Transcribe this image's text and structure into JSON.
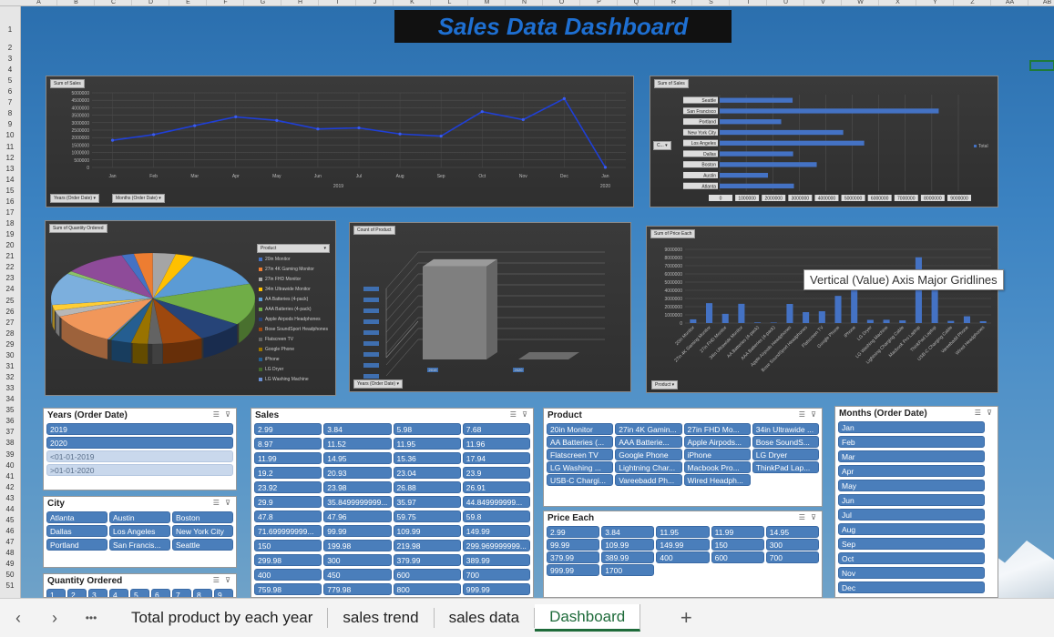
{
  "columns": [
    "A",
    "B",
    "C",
    "D",
    "E",
    "F",
    "G",
    "H",
    "I",
    "J",
    "K",
    "L",
    "M",
    "N",
    "O",
    "P",
    "Q",
    "R",
    "S",
    "T",
    "U",
    "V",
    "W",
    "X",
    "Y",
    "Z",
    "AA",
    "AB"
  ],
  "rows": [
    "1",
    "2",
    "3",
    "4",
    "5",
    "6",
    "7",
    "8",
    "9",
    "10",
    "11",
    "12",
    "13",
    "14",
    "15",
    "16",
    "17",
    "18",
    "19",
    "20",
    "21",
    "22",
    "23",
    "24",
    "25",
    "26",
    "27",
    "28",
    "29",
    "30",
    "31",
    "32",
    "33",
    "34",
    "35",
    "36",
    "37",
    "38",
    "39",
    "40",
    "41",
    "42",
    "43",
    "44",
    "45",
    "46",
    "47",
    "48",
    "49",
    "50",
    "51"
  ],
  "dashboard_title": "Sales Data Dashboard",
  "tooltip": "Vertical (Value) Axis Major Gridlines",
  "charts": {
    "line": {
      "tag": "Sum of Sales",
      "filter1": "Years (Order Date) ▾",
      "filter2": "Months (Order Date) ▾",
      "year1": "2019",
      "year2": "2020"
    },
    "city": {
      "tag": "Sum of Sales",
      "filter": "C... ▾",
      "legend": "Total"
    },
    "pie": {
      "tag": "Sum of Quantity Ordered",
      "legend_title": "Product"
    },
    "bar3d": {
      "tag": "Count of Product",
      "filter": "Years (Order Date) ▾",
      "x1": "2019",
      "x2": "2020"
    },
    "price": {
      "tag": "Sum of Price Each",
      "filter": "Product ▾"
    }
  },
  "chart_data": [
    {
      "type": "line",
      "title": "Sum of Sales",
      "categories": [
        "Jan",
        "Feb",
        "Mar",
        "Apr",
        "May",
        "Jun",
        "Jul",
        "Aug",
        "Sep",
        "Oct",
        "Nov",
        "Dec",
        "Jan"
      ],
      "values": [
        1820000,
        2200000,
        2800000,
        3390000,
        3150000,
        2580000,
        2650000,
        2240000,
        2100000,
        3740000,
        3200000,
        4610000,
        8700
      ],
      "yticks": [
        "5000000",
        "4500000",
        "4000000",
        "3500000",
        "3000000",
        "2500000",
        "2000000",
        "1500000",
        "1000000",
        "500000",
        "0"
      ],
      "ylim": [
        0,
        5000000
      ]
    },
    {
      "type": "bar",
      "title": "Sum of Sales",
      "orientation": "horizontal",
      "categories": [
        "Seattle",
        "San Francisco",
        "Portland",
        "New York City",
        "Los Angeles",
        "Dallas",
        "Boston",
        "Austin",
        "Atlanta"
      ],
      "values": [
        2750000,
        8260000,
        2320000,
        4660000,
        5450000,
        2770000,
        3660000,
        1820000,
        2800000
      ],
      "xticks": [
        "0",
        "1000000",
        "2000000",
        "3000000",
        "4000000",
        "5000000",
        "6000000",
        "7000000",
        "8000000",
        "9000000"
      ],
      "xlim": [
        0,
        9000000
      ],
      "legend": "Total"
    },
    {
      "type": "pie",
      "title": "Sum of Quantity Ordered",
      "labels": [
        "20in Monitor",
        "27in 4K Gaming Monitor",
        "27in FHD Monitor",
        "34in Ultrawide Monitor",
        "AA Batteries (4-pack)",
        "AAA Batteries (4-pack)",
        "Apple Airpods Headphones",
        "Bose SoundSport Headphones",
        "Flatscreen TV",
        "Google Phone",
        "iPhone",
        "LG Dryer",
        "LG Washing Machine",
        "Lightning Charging Cable",
        "Macbook Pro Laptop",
        "ThinkPad Laptop",
        "USB-C Charging Cable",
        "Vareebadd Phone",
        "Wired Headphones"
      ],
      "values": [
        4129,
        6244,
        7550,
        6199,
        27635,
        31017,
        15661,
        13457,
        4819,
        5532,
        6849,
        646,
        666,
        23217,
        4728,
        4130,
        23975,
        2068,
        20557
      ],
      "colors": [
        "#4472c4",
        "#ed7d31",
        "#a5a5a5",
        "#ffc000",
        "#5b9bd5",
        "#70ad47",
        "#264478",
        "#9e480e",
        "#636363",
        "#997300",
        "#255e91",
        "#43682b",
        "#698ed0",
        "#f1975a",
        "#b7b7b7",
        "#ffcd33",
        "#7cafdd",
        "#8cc168",
        "#8e4b99"
      ]
    },
    {
      "type": "bar",
      "title": "Count of Product",
      "categories": [
        "2019",
        "2020"
      ],
      "values": [
        185686,
        34
      ],
      "ylim": [
        0,
        200000
      ]
    },
    {
      "type": "bar",
      "title": "Sum of Price Each",
      "categories": [
        "20in Monitor",
        "27in 4K Gaming Monitor",
        "27in FHD Monitor",
        "34in Ultrawide Monitor",
        "AA Batteries (4-pack)",
        "AAA Batteries (4-pack)",
        "Apple Airpods Headphones",
        "Bose SoundSport Headphones",
        "Flatscreen TV",
        "Google Phone",
        "iPhone",
        "LG Dryer",
        "LG Washing Machine",
        "Lightning Charging Cable",
        "Macbook Pro Laptop",
        "ThinkPad Laptop",
        "USB-C Charging Cable",
        "Vareebadd Phone",
        "Wired Headphones"
      ],
      "values": [
        451068,
        2429637,
        1125974,
        2348718,
        79015,
        61716,
        2332350,
        1332367,
        1440000,
        3315000,
        4794300,
        387600,
        399600,
        323788,
        8030800,
        4127958,
        261740,
        826000,
        226395
      ],
      "yticks": [
        "9000000",
        "8000000",
        "7000000",
        "6000000",
        "5000000",
        "4000000",
        "3000000",
        "2000000",
        "1000000",
        "0"
      ],
      "ylim": [
        0,
        9000000
      ]
    }
  ],
  "slicers": {
    "years": {
      "title": "Years (Order Date)",
      "items": [
        "2019",
        "2020",
        "<01-01-2019",
        ">01-01-2020"
      ]
    },
    "city": {
      "title": "City",
      "items": [
        "Atlanta",
        "Austin",
        "Boston",
        "Dallas",
        "Los Angeles",
        "New York City",
        "Portland",
        "San Francis...",
        "Seattle"
      ]
    },
    "qty": {
      "title": "Quantity Ordered",
      "items": [
        "1",
        "2",
        "3",
        "4",
        "5",
        "6",
        "7",
        "8",
        "9"
      ]
    },
    "sales": {
      "title": "Sales",
      "items": [
        "2.99",
        "3.84",
        "5.98",
        "7.68",
        "8.97",
        "11.52",
        "11.95",
        "11.96",
        "11.99",
        "14.95",
        "15.36",
        "17.94",
        "19.2",
        "20.93",
        "23.04",
        "23.9",
        "23.92",
        "23.98",
        "26.88",
        "26.91",
        "29.9",
        "35.8499999999...",
        "35.97",
        "44.849999999...",
        "47.8",
        "47.96",
        "59.75",
        "59.8",
        "71.699999999...",
        "99.99",
        "109.99",
        "149.99",
        "150",
        "199.98",
        "219.98",
        "299.969999999...",
        "299.98",
        "300",
        "379.99",
        "389.99",
        "400",
        "450",
        "600",
        "700",
        "759.98",
        "779.98",
        "800",
        "999.99"
      ]
    },
    "product": {
      "title": "Product",
      "items": [
        "20in Monitor",
        "27in 4K Gamin...",
        "27in FHD Mo...",
        "34in Ultrawide ...",
        "AA Batteries (...",
        "AAA Batterie...",
        "Apple Airpods...",
        "Bose SoundS...",
        "Flatscreen TV",
        "Google Phone",
        "iPhone",
        "LG Dryer",
        "LG Washing ...",
        "Lightning Char...",
        "Macbook Pro...",
        "ThinkPad Lap...",
        "USB-C Chargi...",
        "Vareebadd Ph...",
        "Wired Headph..."
      ]
    },
    "price": {
      "title": "Price Each",
      "items": [
        "2.99",
        "3.84",
        "11.95",
        "11.99",
        "14.95",
        "99.99",
        "109.99",
        "149.99",
        "150",
        "300",
        "379.99",
        "389.99",
        "400",
        "600",
        "700",
        "999.99",
        "1700"
      ]
    },
    "months": {
      "title": "Months (Order Date)",
      "items": [
        "Jan",
        "Feb",
        "Mar",
        "Apr",
        "May",
        "Jun",
        "Jul",
        "Aug",
        "Sep",
        "Oct",
        "Nov",
        "Dec"
      ]
    }
  },
  "tabs": [
    "Total product by each year",
    "sales trend",
    "sales data",
    "Dashboard"
  ],
  "nav": {
    "prev": "‹",
    "next": "›",
    "more": "•••",
    "add": "+"
  }
}
